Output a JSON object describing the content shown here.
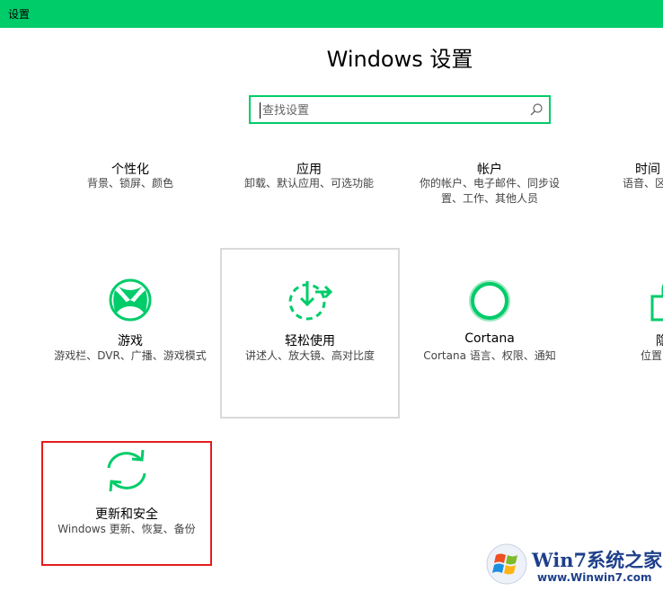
{
  "window": {
    "title": "设置"
  },
  "page": {
    "title": "Windows 设置"
  },
  "search": {
    "placeholder": "查找设置",
    "value": ""
  },
  "categories": [
    {
      "key": "personalization",
      "label": "个性化",
      "desc": "背景、锁屏、颜色",
      "icon": "personalization-icon"
    },
    {
      "key": "apps",
      "label": "应用",
      "desc": "卸载、默认应用、可选功能",
      "icon": "apps-icon"
    },
    {
      "key": "accounts",
      "label": "帐户",
      "desc": "你的帐户、电子邮件、同步设置、工作、其他人员",
      "icon": "accounts-icon"
    },
    {
      "key": "time-language",
      "label": "时间",
      "desc": "语音、区",
      "icon": "time-language-icon"
    },
    {
      "key": "gaming",
      "label": "游戏",
      "desc": "游戏栏、DVR、广播、游戏模式",
      "icon": "xbox-icon"
    },
    {
      "key": "ease-of-access",
      "label": "轻松使用",
      "desc": "讲述人、放大镜、高对比度",
      "icon": "ease-of-access-icon"
    },
    {
      "key": "cortana",
      "label": "Cortana",
      "desc": "Cortana 语言、权限、通知",
      "icon": "cortana-icon"
    },
    {
      "key": "privacy",
      "label": "隐",
      "desc": "位置",
      "icon": "privacy-lock-icon"
    },
    {
      "key": "update-security",
      "label": "更新和安全",
      "desc": "Windows 更新、恢复、备份",
      "icon": "update-sync-icon"
    }
  ],
  "watermark": {
    "brand": "Win7系统之家",
    "url": "www.Winwin7.com"
  },
  "colors": {
    "accent": "#00cc6a",
    "selection": "#e51c1c",
    "hover": "#d9d9d9"
  }
}
